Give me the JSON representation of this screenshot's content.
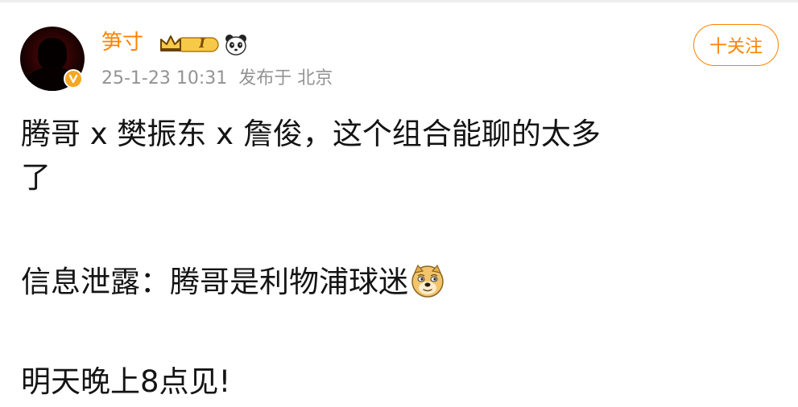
{
  "post": {
    "user": {
      "name": "笋寸",
      "level_badge": "I",
      "badge_icon": "crown-level-badge-icon",
      "extra_icon": "panda-icon",
      "verified_icon": "verified-v-icon"
    },
    "meta": {
      "timestamp": "25-1-23 10:31",
      "source": "发布于 北京"
    },
    "follow_button": {
      "label": "十关注"
    },
    "content": {
      "line1": "腾哥 x 樊振东 x 詹俊，这个组合能聊的太多",
      "line2": "了",
      "line3": "信息泄露：腾哥是利物浦球迷",
      "line3_emoji": "doge-emoji-icon",
      "line4": "明天晚上8点见!"
    }
  },
  "colors": {
    "accent": "#ff8200",
    "meta_text": "#939393",
    "body_text": "#141414",
    "badge_gold": "#f5a623"
  }
}
